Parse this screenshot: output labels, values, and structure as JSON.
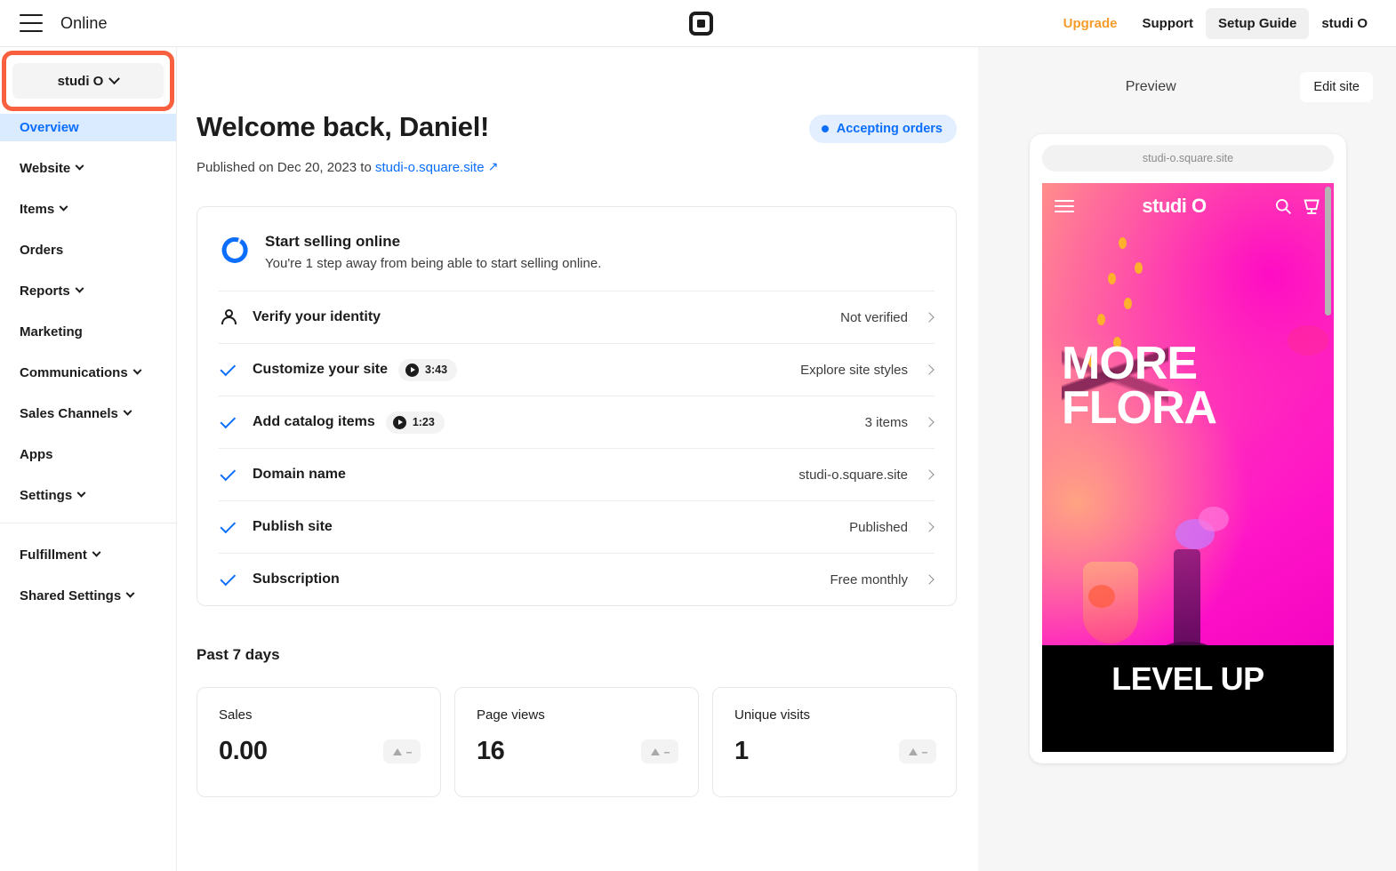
{
  "topbar": {
    "menu_icon": "hamburger-menu-icon",
    "title": "Online",
    "logo_icon": "square-logo-icon",
    "links": [
      {
        "label": "Upgrade",
        "style": "upgrade"
      },
      {
        "label": "Support",
        "style": "normal"
      },
      {
        "label": "Setup Guide",
        "style": "active"
      },
      {
        "label": "studi O",
        "style": "normal"
      }
    ]
  },
  "sidebar": {
    "store_switcher": {
      "label": "studi O",
      "icon": "chevron-down-icon"
    },
    "highlight_color": "#f9603f",
    "items": [
      {
        "label": "Overview",
        "expandable": false,
        "active": true
      },
      {
        "label": "Website",
        "expandable": true,
        "active": false
      },
      {
        "label": "Items",
        "expandable": true,
        "active": false
      },
      {
        "label": "Orders",
        "expandable": false,
        "active": false
      },
      {
        "label": "Reports",
        "expandable": true,
        "active": false
      },
      {
        "label": "Marketing",
        "expandable": false,
        "active": false
      },
      {
        "label": "Communications",
        "expandable": true,
        "active": false
      },
      {
        "label": "Sales Channels",
        "expandable": true,
        "active": false
      },
      {
        "label": "Apps",
        "expandable": false,
        "active": false
      },
      {
        "label": "Settings",
        "expandable": true,
        "active": false
      }
    ],
    "secondary_items": [
      {
        "label": "Fulfillment",
        "expandable": true
      },
      {
        "label": "Shared Settings",
        "expandable": true
      }
    ]
  },
  "main": {
    "welcome_title": "Welcome back, Daniel!",
    "status_badge": {
      "label": "Accepting orders",
      "color": "#0b6efd",
      "bg": "#e3eeff"
    },
    "published_prefix": "Published on Dec 20, 2023 to",
    "published_link": "studi-o.square.site",
    "published_link_icon": "external-link-arrow-icon",
    "checklist_card": {
      "progress_icon": "progress-ring-icon",
      "title": "Start selling online",
      "subtitle": "You're 1 step away from being able to start selling online.",
      "rows": [
        {
          "lead_icon": "person-icon",
          "done": false,
          "label": "Verify your identity",
          "video": null,
          "value": "Not verified"
        },
        {
          "lead_icon": "check-icon",
          "done": true,
          "label": "Customize your site",
          "video": "3:43",
          "value": "Explore site styles"
        },
        {
          "lead_icon": "check-icon",
          "done": true,
          "label": "Add catalog items",
          "video": "1:23",
          "value": "3 items"
        },
        {
          "lead_icon": "check-icon",
          "done": true,
          "label": "Domain name",
          "video": null,
          "value": "studi-o.square.site"
        },
        {
          "lead_icon": "check-icon",
          "done": true,
          "label": "Publish site",
          "video": null,
          "value": "Published"
        },
        {
          "lead_icon": "check-icon",
          "done": true,
          "label": "Subscription",
          "video": null,
          "value": "Free monthly"
        }
      ]
    },
    "stats_section_title": "Past 7 days",
    "stats": [
      {
        "label": "Sales",
        "value": "0.00",
        "trend": "--"
      },
      {
        "label": "Page views",
        "value": "16",
        "trend": "--"
      },
      {
        "label": "Unique visits",
        "value": "1",
        "trend": "--"
      }
    ]
  },
  "preview": {
    "label": "Preview",
    "edit_button": "Edit site",
    "url": "studi-o.square.site",
    "site": {
      "menu_icon": "hamburger-menu-icon",
      "brand": "studi O",
      "search_icon": "search-icon",
      "cart_icon": "shopping-cart-icon",
      "hero_line1": "MORE",
      "hero_line2": "FLORA",
      "band_text": "LEVEL UP"
    }
  }
}
